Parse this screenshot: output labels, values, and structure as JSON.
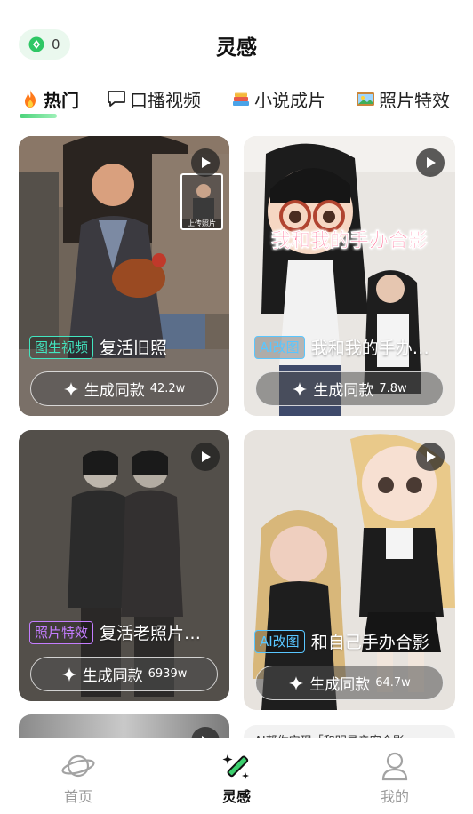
{
  "header": {
    "coin_count": "0",
    "title": "灵感"
  },
  "tabs": [
    {
      "label": "热门",
      "icon": "fire-icon",
      "active": true
    },
    {
      "label": "口播视频",
      "icon": "speech-bubble-icon",
      "active": false
    },
    {
      "label": "小说成片",
      "icon": "books-icon",
      "active": false
    },
    {
      "label": "照片特效",
      "icon": "photo-frame-icon",
      "active": false
    }
  ],
  "cards": [
    {
      "tag": "图生视频",
      "tag_color": "#42e6c0",
      "title": "复活旧照",
      "button_label": "生成同款",
      "count": "42.2w",
      "thumb_text": "上传照片"
    },
    {
      "tag": "AI改图",
      "tag_color": "#59c6ff",
      "title": "我和我的手办…",
      "button_label": "生成同款",
      "count": "7.8w",
      "overlay_text": "我和我的手办合影"
    },
    {
      "tag": "照片特效",
      "tag_color": "#c47dff",
      "title": "复活老照片…",
      "button_label": "生成同款",
      "count": "6939w"
    },
    {
      "tag": "AI改图",
      "tag_color": "#59c6ff",
      "title": "和自己手办合影",
      "button_label": "生成同款",
      "count": "64.7w"
    }
  ],
  "peek_card_text": "AI帮你实现「和明星亲密合影」",
  "bottom_nav": [
    {
      "label": "首页",
      "icon": "planet-icon",
      "active": false
    },
    {
      "label": "灵感",
      "icon": "magic-wand-icon",
      "active": true
    },
    {
      "label": "我的",
      "icon": "user-icon",
      "active": false
    }
  ],
  "colors": {
    "accent_green": "#3ccf6e",
    "coin_bg": "#eaf8ee"
  }
}
